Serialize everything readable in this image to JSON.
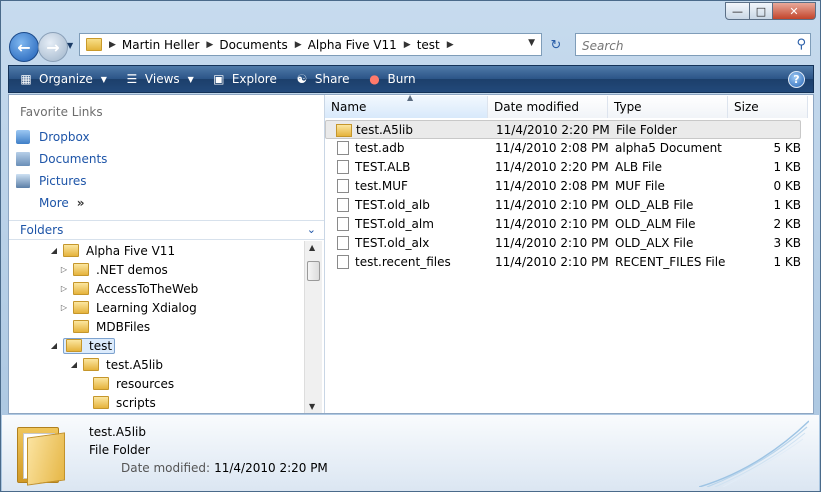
{
  "titlebar": {
    "min_glyph": "—",
    "max_glyph": "□",
    "close_glyph": "✕"
  },
  "address": {
    "crumbs": [
      "Martin Heller",
      "Documents",
      "Alpha Five V11",
      "test"
    ]
  },
  "search": {
    "placeholder": "Search"
  },
  "toolbar": {
    "organize": "Organize",
    "views": "Views",
    "explore": "Explore",
    "share": "Share",
    "burn": "Burn",
    "help": "?"
  },
  "nav": {
    "favorites_header": "Favorite Links",
    "favorites": [
      "Dropbox",
      "Documents",
      "Pictures"
    ],
    "more": "More",
    "folders_header": "Folders",
    "tree": [
      {
        "label": "Alpha Five V11",
        "expanded": true
      },
      {
        "label": ".NET demos"
      },
      {
        "label": "AccessToTheWeb"
      },
      {
        "label": "Learning Xdialog"
      },
      {
        "label": "MDBFiles"
      },
      {
        "label": "test",
        "expanded": true,
        "selected": true
      },
      {
        "label": "test.A5lib",
        "expanded": true
      },
      {
        "label": "resources"
      },
      {
        "label": "scripts"
      }
    ]
  },
  "list": {
    "columns": [
      "Name",
      "Date modified",
      "Type",
      "Size"
    ],
    "rows": [
      {
        "name": "test.A5lib",
        "date": "11/4/2010 2:20 PM",
        "type": "File Folder",
        "size": "",
        "folder": true,
        "selected": true
      },
      {
        "name": "test.adb",
        "date": "11/4/2010 2:08 PM",
        "type": "alpha5 Document",
        "size": "5 KB"
      },
      {
        "name": "TEST.ALB",
        "date": "11/4/2010 2:20 PM",
        "type": "ALB File",
        "size": "1 KB"
      },
      {
        "name": "test.MUF",
        "date": "11/4/2010 2:08 PM",
        "type": "MUF File",
        "size": "0 KB"
      },
      {
        "name": "TEST.old_alb",
        "date": "11/4/2010 2:10 PM",
        "type": "OLD_ALB File",
        "size": "1 KB"
      },
      {
        "name": "TEST.old_alm",
        "date": "11/4/2010 2:10 PM",
        "type": "OLD_ALM File",
        "size": "2 KB"
      },
      {
        "name": "TEST.old_alx",
        "date": "11/4/2010 2:10 PM",
        "type": "OLD_ALX File",
        "size": "3 KB"
      },
      {
        "name": "test.recent_files",
        "date": "11/4/2010 2:10 PM",
        "type": "RECENT_FILES File",
        "size": "1 KB"
      }
    ]
  },
  "details": {
    "name": "test.A5lib",
    "type": "File Folder",
    "date_label": "Date modified:",
    "date_value": "11/4/2010 2:20 PM"
  }
}
